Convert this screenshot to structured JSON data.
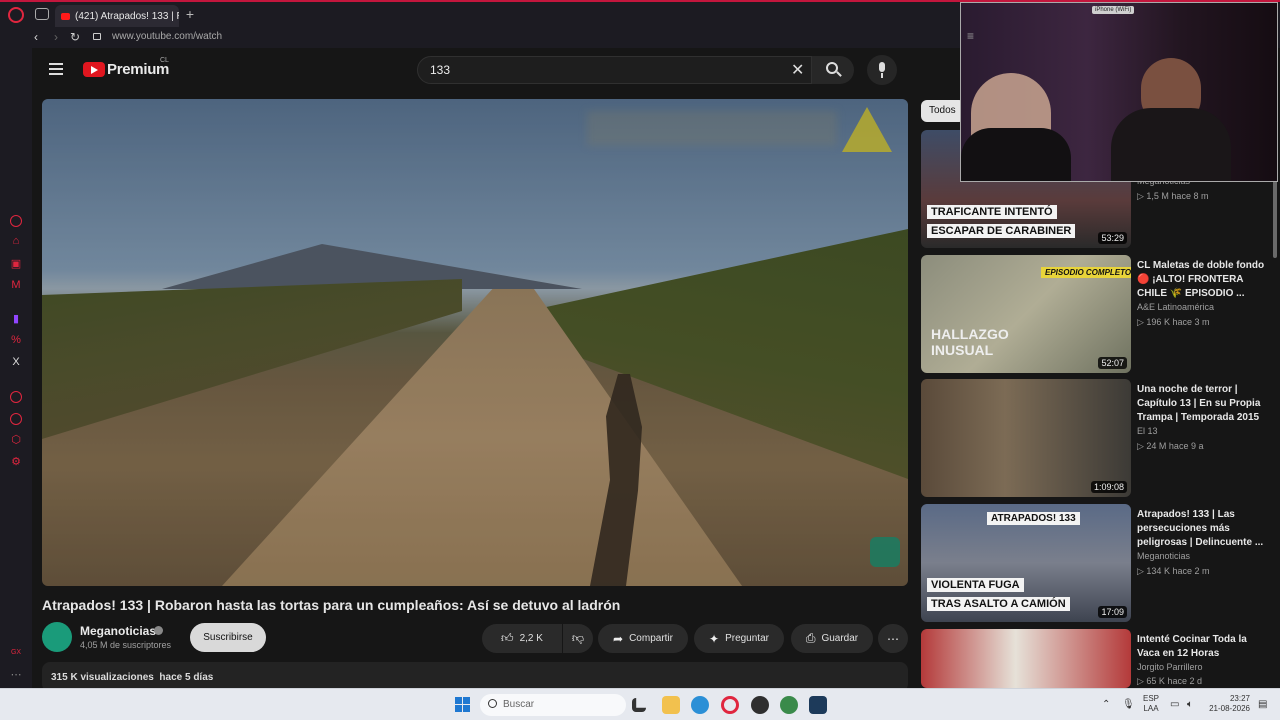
{
  "browser": {
    "tab_title": "(421) Atrapados! 133 | Roba",
    "new_tab": "+",
    "url": "www.youtube.com/watch",
    "accent": "#e0263f"
  },
  "youtube": {
    "brand": "Premium",
    "region": "CL",
    "search_query": "133",
    "video": {
      "title": "Atrapados! 133 | Robaron hasta las tortas para un cumpleaños: Así se detuvo al ladrón",
      "channel": "Meganoticias",
      "subscribers": "4,05 M de suscriptores",
      "subscribe_label": "Suscribirse",
      "likes": "2,2 K",
      "share_label": "Compartir",
      "ask_label": "Preguntar",
      "save_label": "Guardar",
      "views": "315 K visualizaciones",
      "age": "hace 5 días"
    },
    "chip_all": "Todos",
    "recommendations": [
      {
        "banner1": "TRAFICANTE INTENTÓ",
        "banner2": "ESCAPAR DE CARABINER",
        "duration": "53:29",
        "title": "",
        "channel": "Meganoticias",
        "stats": "▷ 1,5 M   hace 8 m"
      },
      {
        "banner1": "EPISODIO COMPLETO",
        "banner2": "HALLAZGO INUSUAL",
        "duration": "52:07",
        "title": "CL Maletas de doble fondo 🔴 ¡ALTO! FRONTERA CHILE 🌾 EPISODIO ...",
        "channel": "A&E Latinoamérica",
        "stats": "▷ 196 K   hace 3 m"
      },
      {
        "banner1": "",
        "banner2": "",
        "duration": "1:09:08",
        "title": "Una noche de terror | Capítulo 13 | En su Propia Trampa | Temporada 2015",
        "channel": "El 13",
        "stats": "▷ 24 M   hace 9 a"
      },
      {
        "banner1": "VIOLENTA FUGA",
        "banner2": "TRAS ASALTO A CAMIÓN",
        "duration": "17:09",
        "title": "Atrapados! 133 | Las persecuciones más peligrosas | Delincuente ...",
        "channel": "Meganoticias",
        "stats": "▷ 134 K   hace 2 m",
        "tag": "ATRAPADOS! 133"
      },
      {
        "banner1": "",
        "banner2": "",
        "duration": "",
        "title": "Intenté Cocinar Toda la Vaca en 12 Horas",
        "channel": "Jorgito Parrillero",
        "stats": "▷ 65 K   hace 2 d"
      }
    ]
  },
  "webcam": {
    "label": "iPhone (WiFi)"
  },
  "taskbar": {
    "search_placeholder": "Buscar",
    "lang1": "ESP",
    "lang2": "LAA",
    "time": "23:27",
    "date": "21-08-2026"
  }
}
